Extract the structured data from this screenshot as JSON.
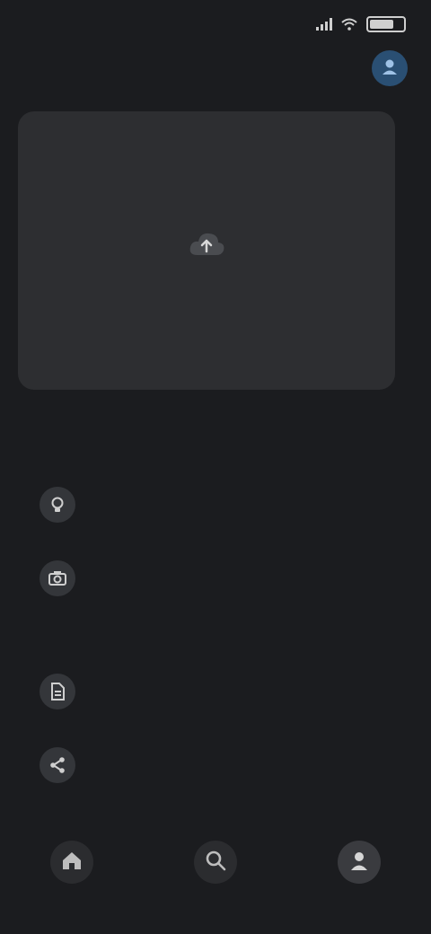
{
  "status": {
    "time": "",
    "icons": [
      "signal-icon",
      "wifi-icon",
      "battery-icon"
    ]
  },
  "header": {
    "title": "",
    "avatar_icon": "person-icon"
  },
  "capture": {
    "label": "",
    "icon": "cloud-upload-icon"
  },
  "section": {
    "title": ""
  },
  "tips": [
    {
      "title": "",
      "subtitle": "",
      "icon": "tip-icon-1"
    },
    {
      "title": "",
      "subtitle": "",
      "icon": "tip-icon-2"
    },
    {
      "title": "",
      "subtitle": "",
      "icon": "tip-icon-3"
    },
    {
      "title": "",
      "subtitle": "",
      "icon": "tip-icon-4"
    }
  ],
  "nav": {
    "items": [
      {
        "icon": "home-icon"
      },
      {
        "icon": "search-icon"
      },
      {
        "icon": "profile-icon"
      }
    ]
  },
  "colors": {
    "background": "#1b1c1f",
    "card": "#2d2e31",
    "accent": "#2a4f73"
  }
}
